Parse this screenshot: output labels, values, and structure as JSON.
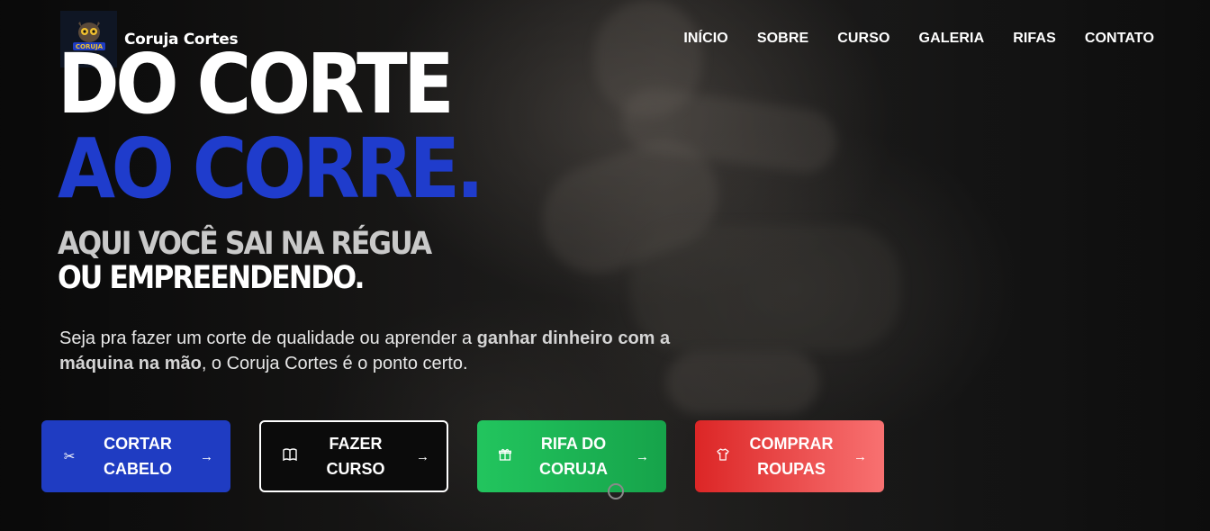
{
  "header": {
    "brand": "Coruja Cortes",
    "logo_text": "CORUJA Cortes",
    "nav": [
      "INÍCIO",
      "SOBRE",
      "CURSO",
      "GALERIA",
      "RIFAS",
      "CONTATO"
    ]
  },
  "hero": {
    "title_line1": "DO CORTE",
    "title_line2": "AO CORRE.",
    "subtitle_line1": "AQUI VOCÊ SAI NA RÉGUA",
    "subtitle_line2": "OU EMPREENDENDO.",
    "description_part1": "Seja pra fazer um corte de qualidade ou aprender a ",
    "description_highlight": "ganhar dinheiro com a máquina na mão",
    "description_part2": ", o Coruja Cortes é o ponto certo."
  },
  "buttons": [
    {
      "line1": "CORTAR",
      "line2": "CABELO",
      "icon": "scissors-icon",
      "color": "#1f3cc2"
    },
    {
      "line1": "FAZER",
      "line2": "CURSO",
      "icon": "book-icon",
      "color": "#0b0b0b"
    },
    {
      "line1": "RIFA DO",
      "line2": "CORUJA",
      "icon": "gift-icon",
      "color": "#22c55e"
    },
    {
      "line1": "COMPRAR",
      "line2": "ROUPAS",
      "icon": "shirt-icon",
      "color": "#dc2626"
    }
  ],
  "colors": {
    "accent_blue": "#1f3ccc",
    "text_white": "#ffffff"
  }
}
